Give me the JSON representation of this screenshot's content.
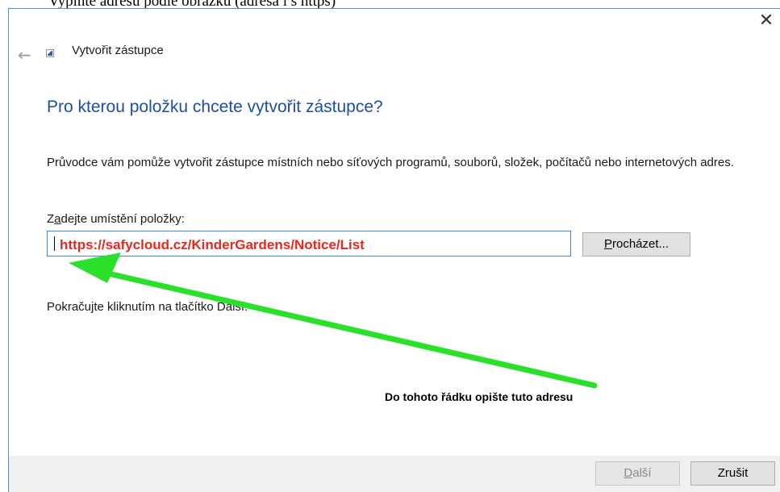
{
  "topbar": {
    "clipped_text": "Vyplňte adresu podle obrázku (adresa i s https)",
    "clipped_link": ""
  },
  "window": {
    "close_glyph": "✕",
    "back_glyph": "←",
    "wizard_title": "Vytvořit zástupce"
  },
  "content": {
    "heading": "Pro kterou položku chcete vytvořit zástupce?",
    "description": "Průvodce vám pomůže vytvořit zástupce místních nebo síťových programů, souborů, složek, počítačů nebo internetových adres.",
    "field_label_pre": "Z",
    "field_label_acc": "a",
    "field_label_post": "dejte umístění položky:",
    "location_value": "https://safycloud.cz/KinderGardens/Notice/List",
    "browse_acc": "P",
    "browse_rest": "rocházet...",
    "continue_text": "Pokračujte kliknutím na tlačítko Další."
  },
  "annotation": {
    "note": "Do tohoto řádku opište tuto adresu",
    "arrow_color": "#2be02b",
    "url_color": "#e8281e"
  },
  "footer": {
    "next_acc": "D",
    "next_rest": "alší",
    "cancel_label": "Zrušit"
  },
  "colors": {
    "heading": "#1f4e9e",
    "input_border": "#3c8ad8",
    "footer_bg": "#f0f0f0"
  }
}
